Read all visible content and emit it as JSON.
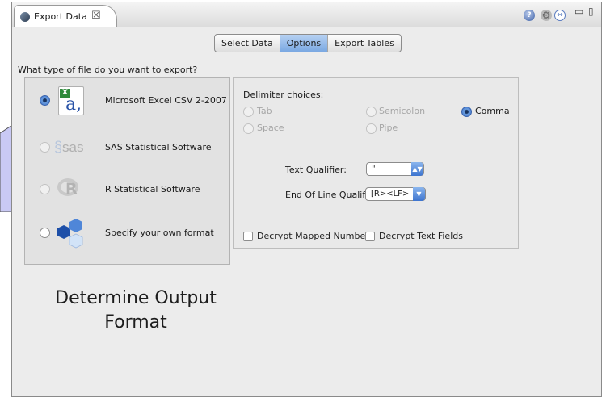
{
  "window": {
    "tab_title": "Export Data",
    "tab_close_glyph": "☒",
    "toolbar_icons": [
      "help-icon",
      "gear-icon",
      "nav-icon"
    ],
    "window_controls": [
      "minimize-icon",
      "maximize-icon"
    ]
  },
  "tabs": {
    "items": [
      "Select Data",
      "Options",
      "Export Tables"
    ],
    "active": "Options"
  },
  "format": {
    "question": "What type of file do you want to export?",
    "options": [
      {
        "label": "Microsoft Excel CSV 2-2007",
        "icon": "excel-icon",
        "selected": true,
        "enabled": true
      },
      {
        "label": "SAS Statistical Software",
        "icon": "sas-icon",
        "icon_text": "sas",
        "selected": false,
        "enabled": false
      },
      {
        "label": "R Statistical Software",
        "icon": "r-icon",
        "icon_text": "R",
        "selected": false,
        "enabled": false
      },
      {
        "label": "Specify your own format",
        "icon": "hexagon-icon",
        "selected": false,
        "enabled": true
      }
    ]
  },
  "delimiter": {
    "heading": "Delimiter choices:",
    "options": [
      {
        "label": "Tab",
        "selected": false,
        "enabled": false
      },
      {
        "label": "Semicolon",
        "selected": false,
        "enabled": false
      },
      {
        "label": "Comma",
        "selected": true,
        "enabled": true
      },
      {
        "label": "Space",
        "selected": false,
        "enabled": false
      },
      {
        "label": "Pipe",
        "selected": false,
        "enabled": false
      }
    ]
  },
  "qualifier": {
    "label": "Text Qualifier:",
    "value": "\""
  },
  "eol": {
    "label": "End Of Line Qualifi",
    "value": "[R><LF>"
  },
  "checkboxes": [
    {
      "label": "Decrypt Mapped Numbers",
      "checked": false
    },
    {
      "label": "Decrypt Text Fields",
      "checked": false
    }
  ],
  "caption": {
    "line1": "Determine Output",
    "line2": "Format"
  },
  "colors": {
    "accent": "#4c7fd0",
    "callout_fill": "#c9c9f4",
    "panel": "#e2e2e2"
  }
}
